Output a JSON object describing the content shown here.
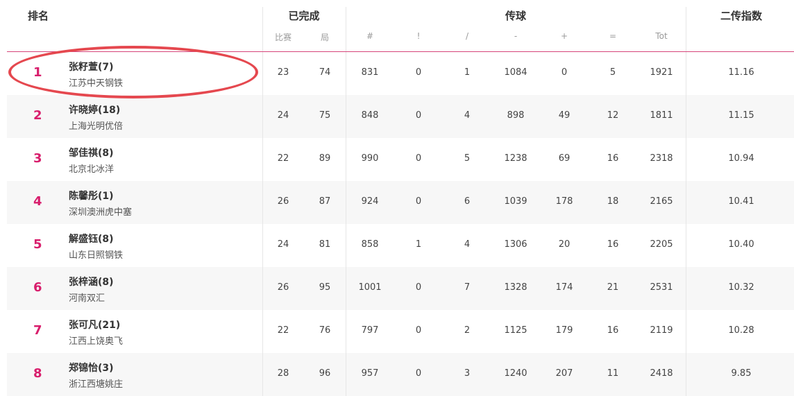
{
  "header": {
    "rank_label": "排名",
    "completed_label": "已完成",
    "passing_label": "传球",
    "index_label": "二传指数",
    "sub": {
      "matches": "比赛",
      "sets": "局",
      "hash": "#",
      "excl": "!",
      "slash": "/",
      "minus": "-",
      "plus": "+",
      "equal": "=",
      "tot": "Tot"
    }
  },
  "rows": [
    {
      "rank": "1",
      "name": "张籽萱(7)",
      "team": "江苏中天钢铁",
      "matches": "23",
      "sets": "74",
      "hash": "831",
      "excl": "0",
      "slash": "1",
      "minus": "1084",
      "plus": "0",
      "equal": "5",
      "tot": "1921",
      "index": "11.16"
    },
    {
      "rank": "2",
      "name": "许晓婷(18)",
      "team": "上海光明优倍",
      "matches": "24",
      "sets": "75",
      "hash": "848",
      "excl": "0",
      "slash": "4",
      "minus": "898",
      "plus": "49",
      "equal": "12",
      "tot": "1811",
      "index": "11.15"
    },
    {
      "rank": "3",
      "name": "邹佳祺(8)",
      "team": "北京北冰洋",
      "matches": "22",
      "sets": "89",
      "hash": "990",
      "excl": "0",
      "slash": "5",
      "minus": "1238",
      "plus": "69",
      "equal": "16",
      "tot": "2318",
      "index": "10.94"
    },
    {
      "rank": "4",
      "name": "陈馨彤(1)",
      "team": "深圳澳洲虎中塞",
      "matches": "26",
      "sets": "87",
      "hash": "924",
      "excl": "0",
      "slash": "6",
      "minus": "1039",
      "plus": "178",
      "equal": "18",
      "tot": "2165",
      "index": "10.41"
    },
    {
      "rank": "5",
      "name": "解盛钰(8)",
      "team": "山东日照钢铁",
      "matches": "24",
      "sets": "81",
      "hash": "858",
      "excl": "1",
      "slash": "4",
      "minus": "1306",
      "plus": "20",
      "equal": "16",
      "tot": "2205",
      "index": "10.40"
    },
    {
      "rank": "6",
      "name": "张梓涵(8)",
      "team": "河南双汇",
      "matches": "26",
      "sets": "95",
      "hash": "1001",
      "excl": "0",
      "slash": "7",
      "minus": "1328",
      "plus": "174",
      "equal": "21",
      "tot": "2531",
      "index": "10.32"
    },
    {
      "rank": "7",
      "name": "张可凡(21)",
      "team": "江西上饶奥飞",
      "matches": "22",
      "sets": "76",
      "hash": "797",
      "excl": "0",
      "slash": "2",
      "minus": "1125",
      "plus": "179",
      "equal": "16",
      "tot": "2119",
      "index": "10.28"
    },
    {
      "rank": "8",
      "name": "郑锦怡(3)",
      "team": "浙江西塘姚庄",
      "matches": "28",
      "sets": "96",
      "hash": "957",
      "excl": "0",
      "slash": "3",
      "minus": "1240",
      "plus": "207",
      "equal": "11",
      "tot": "2418",
      "index": "9.85"
    }
  ]
}
